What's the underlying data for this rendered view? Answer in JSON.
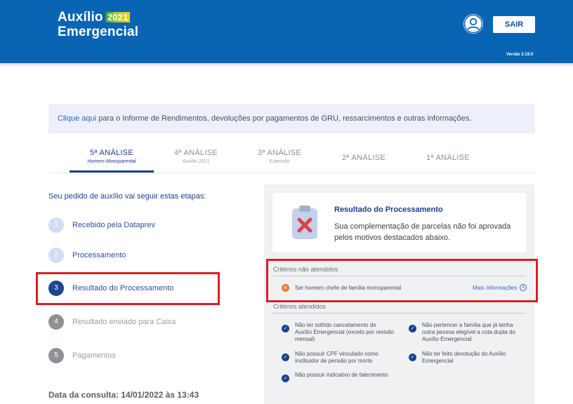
{
  "header": {
    "logo_line1": "Auxílio",
    "logo_year": "2021",
    "logo_line2": "Emergencial",
    "logout_label": "SAIR",
    "version": "Versão 2.19.0"
  },
  "info_bar": {
    "link_text": "Clique aqui",
    "text": " para o Informe de Rendimentos, devoluções por pagamentos de GRU, ressarcimentos e outras informações."
  },
  "tabs": [
    {
      "label": "5ª ANÁLISE",
      "sub": "Homem Monoparental",
      "active": true
    },
    {
      "label": "4ª ANÁLISE",
      "sub": "Auxílio 2021"
    },
    {
      "label": "3ª ANÁLISE",
      "sub": "Extensão"
    },
    {
      "label": "2ª ANÁLISE",
      "sub": ""
    },
    {
      "label": "1ª ANÁLISE",
      "sub": ""
    }
  ],
  "steps": {
    "title": "Seu pedido de auxílio vai seguir estas etapas:",
    "items": [
      {
        "num": "1",
        "label": "Recebido pela Dataprev"
      },
      {
        "num": "2",
        "label": "Processamento"
      },
      {
        "num": "3",
        "label": "Resultado do Processamento"
      },
      {
        "num": "4",
        "label": "Resultado enviado para Caixa"
      },
      {
        "num": "5",
        "label": "Pagamentos"
      }
    ]
  },
  "consult_date": {
    "label": "Data da consulta: ",
    "value": "14/01/2022 às 13:43"
  },
  "result": {
    "title": "Resultado do Processamento",
    "text": "Sua complementação de parcelas não foi aprovada pelos motivos destacados abaixo."
  },
  "criteria_not_met": {
    "title": "Critérios não atendidos",
    "items": [
      {
        "text": "Ser homem chefe de família monoparental",
        "more_info": "Mais Informações"
      }
    ]
  },
  "criteria_met": {
    "title": "Critérios atendidos",
    "items": [
      "Não ter sofrido cancelamento do Auxílio Emergencial (exceto por revisão mensal)",
      "Não pertencer a família que já tenha outra pessoa elegível a cota dupla do Auxílio Emergencial",
      "Não possuir CPF vinculado como instituidor de pensão por morte",
      "Não ter feito devolução do Auxílio Emergencial",
      "Não possuir indicativo de falecimento"
    ]
  },
  "colors": {
    "header_blue": "#0a64b4",
    "primary_dark": "#1f3e8c",
    "highlight_red": "#d81e2a",
    "fail_orange": "#e8782a"
  }
}
